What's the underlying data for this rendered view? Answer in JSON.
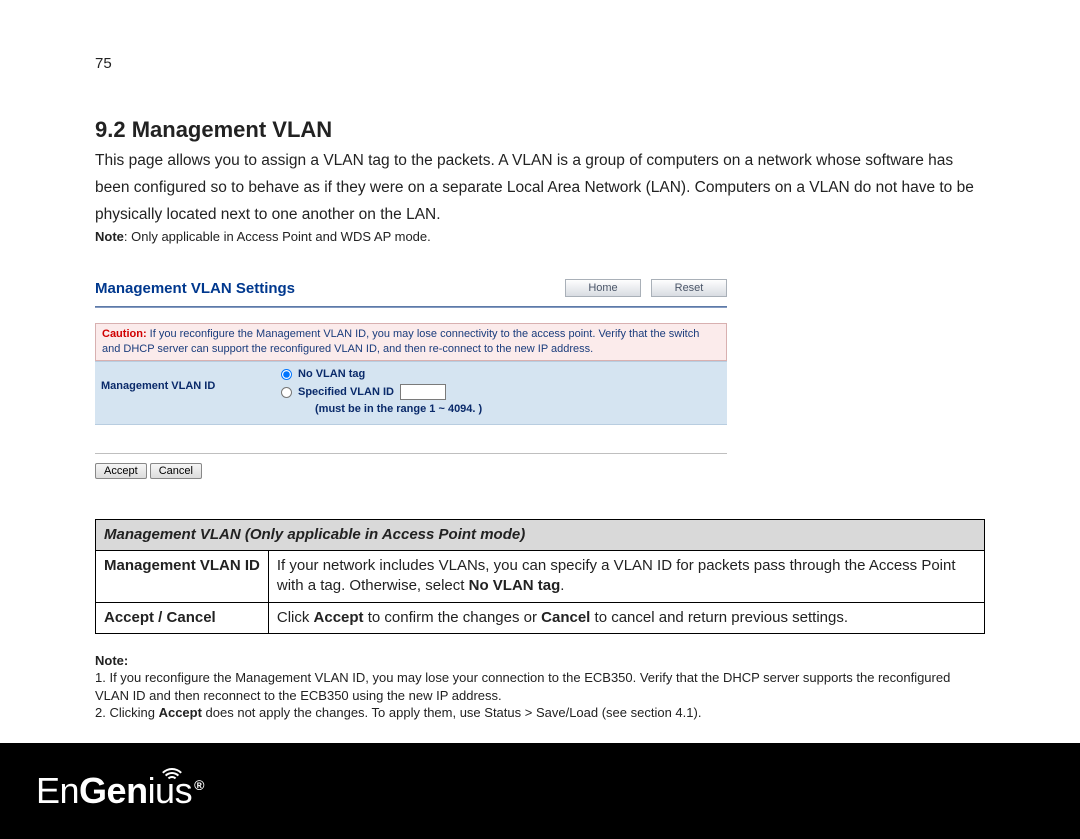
{
  "page_number": "75",
  "section_heading": "9.2   Management VLAN",
  "intro_text": "This page allows you to assign a VLAN tag to the packets. A VLAN is a group of computers on a network whose software has been configured so to behave as if they were on a separate Local Area Network (LAN). Computers on a VLAN do not have to be physically located next to one another on the LAN.",
  "applicable_note_label": "Note",
  "applicable_note_text": ": Only applicable in Access Point and WDS AP mode.",
  "settings": {
    "title": "Management VLAN Settings",
    "home_btn": "Home",
    "reset_btn": "Reset",
    "caution_label": "Caution:",
    "caution_text": " If you reconfigure the Management VLAN ID, you may lose connectivity to the access point. Verify that the switch and DHCP server can support the reconfigured VLAN ID, and then re-connect to the new IP address.",
    "row_label": "Management VLAN ID",
    "opt_no_vlan": "No VLAN tag",
    "opt_specified": "Specified VLAN ID",
    "range_hint": "(must be in the range 1 ~ 4094. )",
    "accept_btn": "Accept",
    "cancel_btn": "Cancel",
    "input_value": ""
  },
  "desc_table": {
    "header": "Management VLAN (Only applicable in Access Point mode)",
    "rows": [
      {
        "label": "Management VLAN ID",
        "text_pre": "If your network includes VLANs, you can specify a VLAN ID for packets pass through the Access Point with a tag. Otherwise, select ",
        "text_bold": "No VLAN tag",
        "text_post": "."
      },
      {
        "label": "Accept / Cancel",
        "text_pre": "Click ",
        "text_b1": "Accept",
        "text_mid": " to confirm the changes or ",
        "text_b2": "Cancel",
        "text_post": " to cancel and return previous settings."
      }
    ]
  },
  "footnotes": {
    "label": "Note:",
    "n1": "1. If you reconfigure the Management VLAN ID, you may lose your connection to the ECB350. Verify that the DHCP server supports the reconfigured VLAN ID and then reconnect to the ECB350 using the new IP address.",
    "n2_pre": "2. Clicking ",
    "n2_b": "Accept",
    "n2_post": " does not apply the changes. To apply them, use Status > Save/Load (see section 4.1)."
  },
  "brand": {
    "part1": "En",
    "part2": "Gen",
    "part3": "ius",
    "reg": "®"
  }
}
